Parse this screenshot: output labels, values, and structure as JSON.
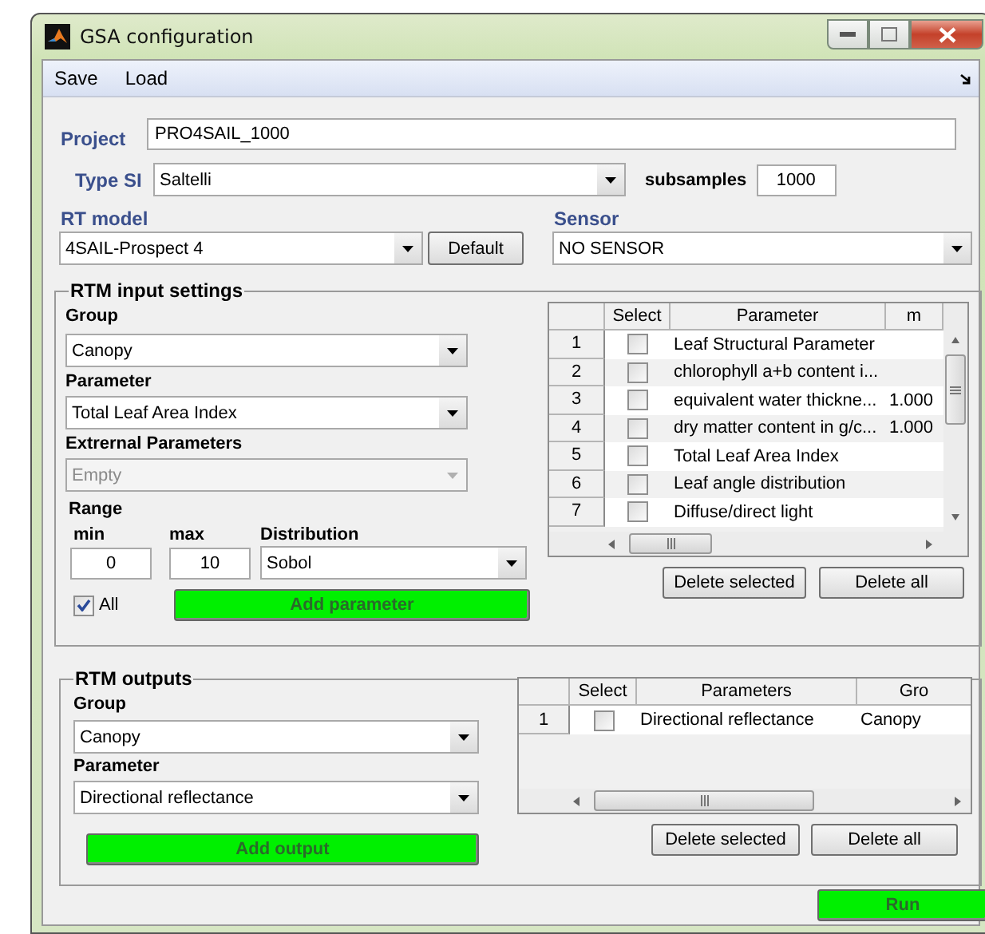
{
  "window": {
    "title": "GSA configuration"
  },
  "menu": [
    {
      "label": "Save"
    },
    {
      "label": "Load"
    }
  ],
  "project": {
    "label": "Project",
    "value": "PRO4SAIL_1000"
  },
  "type_si": {
    "label": "Type SI",
    "value": "Saltelli"
  },
  "subsamples": {
    "label": "subsamples",
    "value": "1000"
  },
  "rt_model": {
    "label": "RT model",
    "value": "4SAIL-Prospect 4"
  },
  "default_button": "Default",
  "sensor": {
    "label": "Sensor",
    "value": "NO SENSOR"
  },
  "input_settings": {
    "title": "RTM input settings",
    "group": {
      "label": "Group",
      "value": "Canopy"
    },
    "parameter": {
      "label": "Parameter",
      "value": "Total Leaf Area Index"
    },
    "external": {
      "label": "Extrernal Parameters",
      "value": "Empty",
      "disabled": true
    },
    "range_label": "Range",
    "min": {
      "label": "min",
      "value": "0"
    },
    "max": {
      "label": "max",
      "value": "10"
    },
    "distribution": {
      "label": "Distribution",
      "value": "Sobol"
    },
    "all": {
      "label": "All",
      "checked": true
    },
    "add_button": "Add parameter",
    "table": {
      "columns": [
        "Select",
        "Parameter",
        "m"
      ],
      "rows": [
        {
          "index": "1",
          "checked": false,
          "parameter": "Leaf Structural Parameter"
        },
        {
          "index": "2",
          "checked": false,
          "parameter": "chlorophyll a+b content i..."
        },
        {
          "index": "3",
          "checked": false,
          "parameter": "equivalent water thickne...",
          "column_3": "1.000"
        },
        {
          "index": "4",
          "checked": false,
          "parameter": "dry matter content in g/c...",
          "column_3": "1.000"
        },
        {
          "index": "5",
          "checked": false,
          "parameter": "Total Leaf Area Index"
        },
        {
          "index": "6",
          "checked": false,
          "parameter": "Leaf angle distribution"
        },
        {
          "index": "7",
          "checked": false,
          "parameter": "Diffuse/direct light"
        }
      ]
    },
    "delete_selected": "Delete selected",
    "delete_all": "Delete all"
  },
  "outputs": {
    "title": "RTM outputs",
    "group": {
      "label": "Group",
      "value": "Canopy"
    },
    "parameter": {
      "label": "Parameter",
      "value": "Directional reflectance"
    },
    "add_button": "Add output",
    "table": {
      "columns": [
        "Select",
        "Parameters",
        "Gro"
      ],
      "rows": [
        {
          "index": "1",
          "checked": false,
          "parameter": "Directional reflectance",
          "column_3": "Canopy"
        }
      ]
    },
    "delete_selected": "Delete selected",
    "delete_all": "Delete all"
  },
  "run_button": "Run"
}
